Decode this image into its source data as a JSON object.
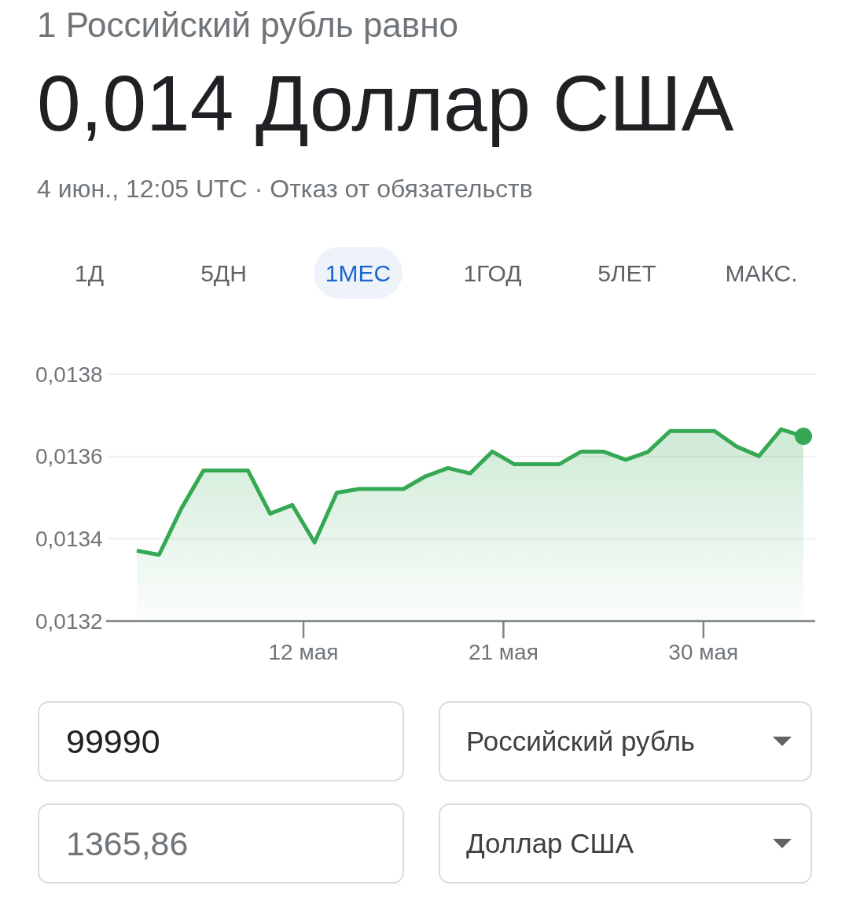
{
  "header": {
    "subtitle": "1 Российский рубль равно",
    "rate": "0,014 Доллар США",
    "timestamp": "4 июн., 12:05 UTC",
    "separator": "·",
    "disclaimer_link": "Отказ от обязательств"
  },
  "range_tabs": [
    {
      "label": "1Д",
      "selected": false
    },
    {
      "label": "5ДН",
      "selected": false
    },
    {
      "label": "1МЕС",
      "selected": true
    },
    {
      "label": "1ГОД",
      "selected": false
    },
    {
      "label": "5ЛЕТ",
      "selected": false
    },
    {
      "label": "МАКС.",
      "selected": false
    }
  ],
  "chart": {
    "chart_data": {
      "type": "area",
      "x": [
        4.5,
        5.5,
        6.5,
        7.5,
        8.5,
        9.5,
        10.5,
        11.5,
        12.5,
        13.5,
        14.5,
        15.5,
        16.5,
        17.5,
        18.5,
        19.5,
        20.5,
        21.5,
        22.5,
        23.5,
        24.5,
        25.5,
        26.5,
        27.5,
        28.5,
        29.5,
        30.5,
        31.5,
        32.5,
        33.5,
        34.5
      ],
      "series": [
        {
          "color": "#34a853",
          "values": [
            0.013371,
            0.013361,
            0.013473,
            0.013566,
            0.013566,
            0.013566,
            0.013461,
            0.013482,
            0.013391,
            0.013512,
            0.013521,
            0.013521,
            0.013521,
            0.013552,
            0.013572,
            0.013559,
            0.013612,
            0.013581,
            0.013581,
            0.013581,
            0.013612,
            0.013612,
            0.013592,
            0.013611,
            0.013662,
            0.013662,
            0.013662,
            0.013624,
            0.013601,
            0.013666,
            0.013649
          ]
        }
      ],
      "xlim": [
        3.12,
        35.03
      ],
      "ylim": [
        0.0132,
        0.0138
      ],
      "xticks": [
        {
          "value": 12,
          "label": "12 мая"
        },
        {
          "value": 21,
          "label": "21 мая"
        },
        {
          "value": 30,
          "label": "30 мая"
        }
      ],
      "yticks": [
        {
          "value": 0.0138,
          "label": "0,0138"
        },
        {
          "value": 0.0136,
          "label": "0,0136"
        },
        {
          "value": 0.0134,
          "label": "0,0134"
        },
        {
          "value": 0.0132,
          "label": "0,0132"
        }
      ]
    }
  },
  "converter": {
    "rows": [
      {
        "amount": {
          "kind": "input",
          "value": "99990"
        },
        "currency": "Российский рубль"
      },
      {
        "amount": {
          "kind": "result",
          "value": "1365,86"
        },
        "currency": "Доллар США"
      }
    ]
  }
}
